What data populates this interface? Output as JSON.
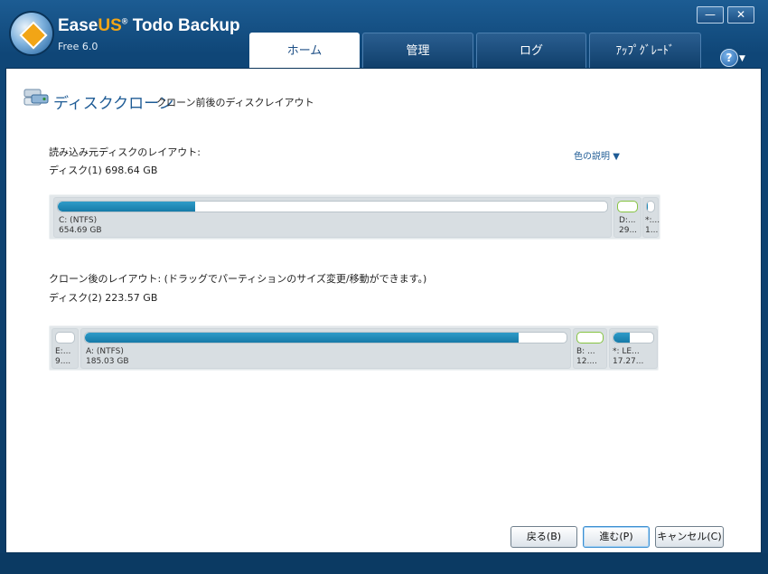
{
  "app": {
    "brand_prefix": "Ease",
    "brand_accent": "US",
    "brand_reg": "®",
    "brand_suffix": " Todo Backup",
    "edition": "Free 6.0"
  },
  "window_controls": {
    "minimize": "—",
    "close": "✕"
  },
  "tabs": [
    {
      "label": "ホーム",
      "active": true
    },
    {
      "label": "管理",
      "active": false
    },
    {
      "label": "ログ",
      "active": false
    },
    {
      "label": "ｱｯﾌﾟｸﾞﾚｰﾄﾞ",
      "active": false
    }
  ],
  "help": {
    "label": "?",
    "arrow": "▼"
  },
  "page": {
    "title": "ディスククローン",
    "subtitle": "クローン前後のディスクレイアウト"
  },
  "source": {
    "heading": "読み込み元ディスクのレイアウト:",
    "disk_label": "ディスク(1) 698.64 GB",
    "partitions": [
      {
        "name": "C: (NTFS)",
        "size": "654.69 GB",
        "fill": 0.25
      },
      {
        "name": "D:...",
        "size": "29...",
        "fill": 0.0
      },
      {
        "name": "*:...",
        "size": "1...",
        "fill": 0.15
      }
    ]
  },
  "legend": {
    "label": "色の説明",
    "arrow": "▼"
  },
  "target": {
    "heading": "クローン後のレイアウト: (ドラッグでパーティションのサイズ変更/移動ができます。)",
    "disk_label": "ディスク(2) 223.57 GB",
    "partitions": [
      {
        "name": "E:...",
        "size": "9....",
        "fill": 0.0
      },
      {
        "name": "A: (NTFS)",
        "size": "185.03 GB",
        "fill": 0.9
      },
      {
        "name": "B: ...",
        "size": "12....",
        "fill": 0.0
      },
      {
        "name": "*: LE...",
        "size": "17.27...",
        "fill": 0.4
      }
    ]
  },
  "buttons": {
    "back": "戻る(B)",
    "next": "進む(P)",
    "cancel": "キャンセル(C)"
  },
  "colors": {
    "accent": "#1e5b95",
    "bar_fill": "#1a86b6",
    "tab_bg": "#154b7c"
  }
}
